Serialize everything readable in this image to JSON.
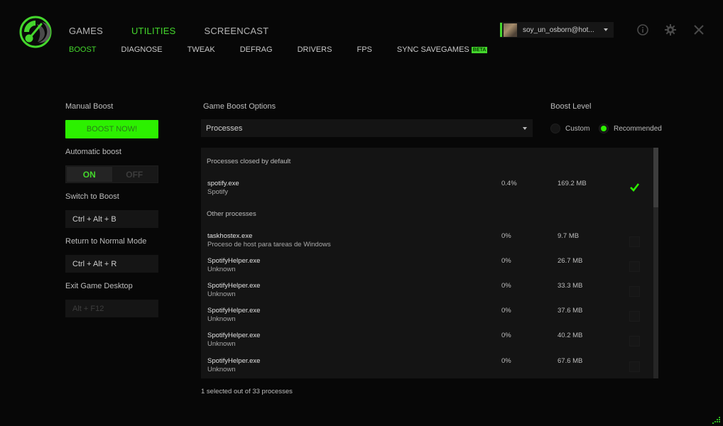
{
  "app": {
    "name": "Razer Cortex",
    "accent_color": "#44d62c"
  },
  "topnav": [
    {
      "label": "GAMES",
      "active": false
    },
    {
      "label": "UTILITIES",
      "active": true
    },
    {
      "label": "SCREENCAST",
      "active": false
    }
  ],
  "subnav": [
    {
      "label": "BOOST",
      "active": true
    },
    {
      "label": "DIAGNOSE",
      "active": false
    },
    {
      "label": "TWEAK",
      "active": false
    },
    {
      "label": "DEFRAG",
      "active": false
    },
    {
      "label": "DRIVERS",
      "active": false
    },
    {
      "label": "FPS",
      "active": false
    },
    {
      "label": "SYNC SAVEGAMES",
      "active": false,
      "badge": "BETA"
    }
  ],
  "account": {
    "username": "soy_un_osborn@hot...",
    "avatar_icon": "user-avatar"
  },
  "window_icons": {
    "info": "info-icon",
    "settings": "gear-icon",
    "close": "close-icon"
  },
  "left_panel": {
    "manual_boost_label": "Manual Boost",
    "boost_now_label": "BOOST NOW!",
    "automatic_boost_label": "Automatic boost",
    "toggle_on": "ON",
    "toggle_off": "OFF",
    "automatic_boost_state": "ON",
    "switch_to_boost_label": "Switch to Boost",
    "switch_to_boost_hotkey": "Ctrl + Alt + B",
    "return_normal_label": "Return to Normal Mode",
    "return_normal_hotkey": "Ctrl + Alt + R",
    "exit_desktop_label": "Exit Game Desktop",
    "exit_desktop_hotkey": "Alt + F12"
  },
  "options": {
    "title": "Game Boost Options",
    "selected": "Processes"
  },
  "boost_level": {
    "title": "Boost Level",
    "options": [
      {
        "label": "Custom",
        "selected": false
      },
      {
        "label": "Recommended",
        "selected": true
      }
    ]
  },
  "processes": {
    "default_section": "Processes closed by default",
    "other_section": "Other processes",
    "default_list": [
      {
        "name": "spotify.exe",
        "desc": "Spotify",
        "cpu": "0.4%",
        "mem": "169.2 MB",
        "checked": true
      }
    ],
    "other_list": [
      {
        "name": "taskhostex.exe",
        "desc": "Proceso de host para tareas de Windows",
        "cpu": "0%",
        "mem": "9.7 MB",
        "checked": false
      },
      {
        "name": "SpotifyHelper.exe",
        "desc": "Unknown",
        "cpu": "0%",
        "mem": "26.7 MB",
        "checked": false
      },
      {
        "name": "SpotifyHelper.exe",
        "desc": "Unknown",
        "cpu": "0%",
        "mem": "33.3 MB",
        "checked": false
      },
      {
        "name": "SpotifyHelper.exe",
        "desc": "Unknown",
        "cpu": "0%",
        "mem": "37.6 MB",
        "checked": false
      },
      {
        "name": "SpotifyHelper.exe",
        "desc": "Unknown",
        "cpu": "0%",
        "mem": "40.2 MB",
        "checked": false
      },
      {
        "name": "SpotifyHelper.exe",
        "desc": "Unknown",
        "cpu": "0%",
        "mem": "67.6 MB",
        "checked": false
      }
    ],
    "status": "1 selected out of 33 processes"
  }
}
